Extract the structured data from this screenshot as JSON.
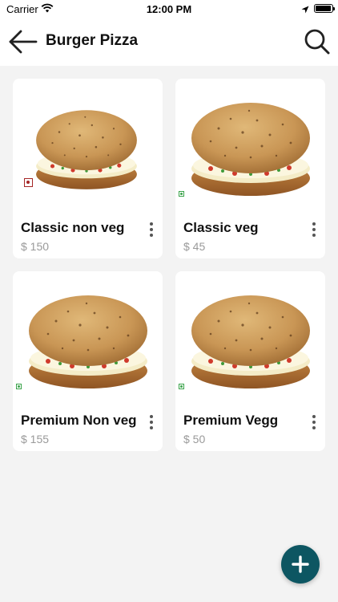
{
  "status_bar": {
    "carrier": "Carrier",
    "time": "12:00 PM",
    "icons": [
      "wifi-icon",
      "location-arrow-icon",
      "battery-icon"
    ]
  },
  "header": {
    "title": "Burger Pizza",
    "back_icon": "arrow-left-icon",
    "search_icon": "search-icon"
  },
  "products": [
    {
      "name": "Classic non veg",
      "price": "$ 150",
      "type": "non-veg",
      "image": "burger-pizza-image"
    },
    {
      "name": "Classic veg",
      "price": "$ 45",
      "type": "veg",
      "image": "burger-pizza-image"
    },
    {
      "name": "Premium Non veg",
      "price": "$ 155",
      "type": "veg",
      "image": "burger-pizza-image"
    },
    {
      "name": "Premium Vegg",
      "price": "$ 50",
      "type": "veg",
      "image": "burger-pizza-image"
    }
  ],
  "fab": {
    "icon": "plus-icon"
  },
  "colors": {
    "accent": "#0d5662",
    "background": "#f3f3f3",
    "card": "#ffffff",
    "price_text": "#9a9a9a",
    "veg_mark": "#3aa34a",
    "nonveg_mark": "#a52626"
  }
}
